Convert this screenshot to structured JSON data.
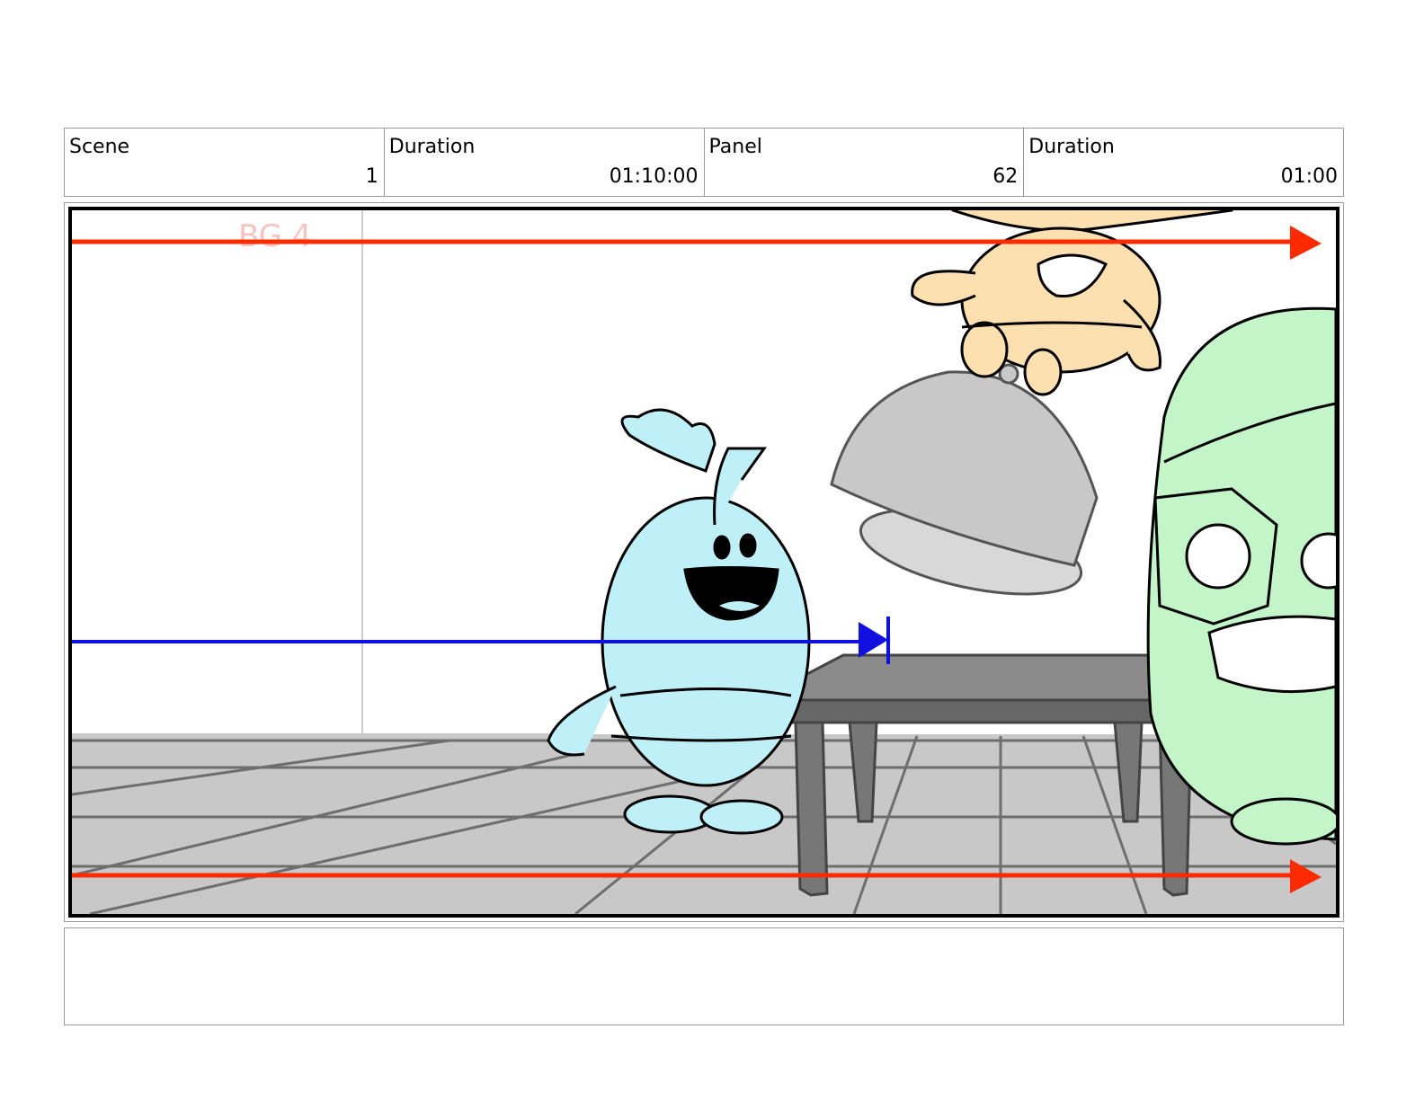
{
  "header": {
    "scene_label": "Scene",
    "scene_value": "1",
    "scene_duration_label": "Duration",
    "scene_duration_value": "01:10:00",
    "panel_label": "Panel",
    "panel_value": "62",
    "panel_duration_label": "Duration",
    "panel_duration_value": "01:00"
  },
  "panel": {
    "bg_sketch_note": "BG 4",
    "colors": {
      "camera_arrow": "#ff2a00",
      "action_arrow": "#1010e0",
      "blue_character": "#bff0f8",
      "orange_character": "#fde0b0",
      "green_character": "#c3f5c9",
      "floor": "#c8c8c8"
    }
  },
  "notes": {
    "text": ""
  }
}
